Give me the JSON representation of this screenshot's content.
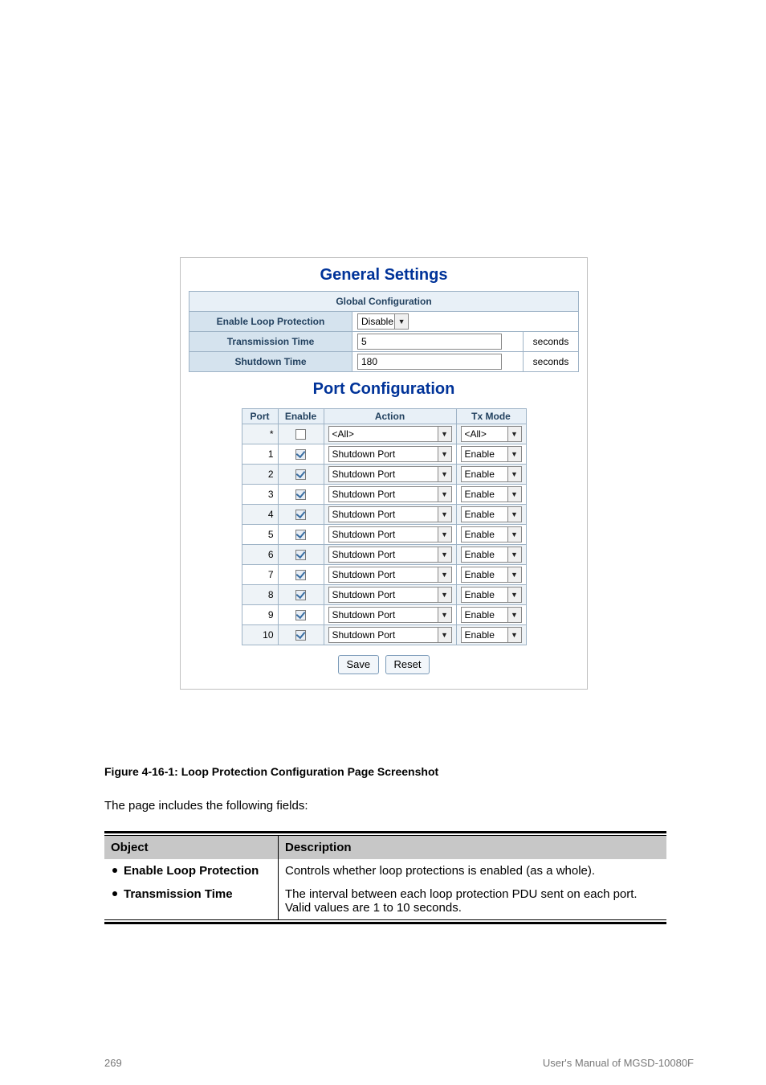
{
  "footer": {
    "left": "269",
    "right": "User's Manual of MGSD-10080F"
  },
  "shot": {
    "title_general": "General Settings",
    "global_head": "Global Configuration",
    "rows": {
      "enable_loop_label": "Enable Loop Protection",
      "enable_loop_value": "Disable",
      "tx_time_label": "Transmission Time",
      "tx_time_value": "5",
      "shutdown_label": "Shutdown Time",
      "shutdown_value": "180",
      "unit": "seconds"
    },
    "title_port": "Port Configuration",
    "headers": {
      "port": "Port",
      "enable": "Enable",
      "action": "Action",
      "tx": "Tx Mode"
    },
    "all_row": {
      "port": "*",
      "enable": false,
      "action": "<All>",
      "tx": "<All>"
    },
    "ports": [
      {
        "port": "1",
        "enable": true,
        "action": "Shutdown Port",
        "tx": "Enable"
      },
      {
        "port": "2",
        "enable": true,
        "action": "Shutdown Port",
        "tx": "Enable"
      },
      {
        "port": "3",
        "enable": true,
        "action": "Shutdown Port",
        "tx": "Enable"
      },
      {
        "port": "4",
        "enable": true,
        "action": "Shutdown Port",
        "tx": "Enable"
      },
      {
        "port": "5",
        "enable": true,
        "action": "Shutdown Port",
        "tx": "Enable"
      },
      {
        "port": "6",
        "enable": true,
        "action": "Shutdown Port",
        "tx": "Enable"
      },
      {
        "port": "7",
        "enable": true,
        "action": "Shutdown Port",
        "tx": "Enable"
      },
      {
        "port": "8",
        "enable": true,
        "action": "Shutdown Port",
        "tx": "Enable"
      },
      {
        "port": "9",
        "enable": true,
        "action": "Shutdown Port",
        "tx": "Enable"
      },
      {
        "port": "10",
        "enable": true,
        "action": "Shutdown Port",
        "tx": "Enable"
      }
    ],
    "buttons": {
      "save": "Save",
      "reset": "Reset"
    }
  },
  "caption": {
    "fig": "Figure 4-16-1:",
    "text": "Loop Protection Configuration Page Screenshot"
  },
  "para": "The page includes the following fields:",
  "desc": {
    "head_obj": "Object",
    "head_desc": "Description",
    "items": [
      {
        "obj": "Enable Loop Protection",
        "desc": "Controls whether loop protections is enabled (as a whole)."
      },
      {
        "obj": "Transmission Time",
        "desc": "The interval between each loop protection PDU sent on each port. Valid values are 1 to 10 seconds."
      }
    ]
  }
}
